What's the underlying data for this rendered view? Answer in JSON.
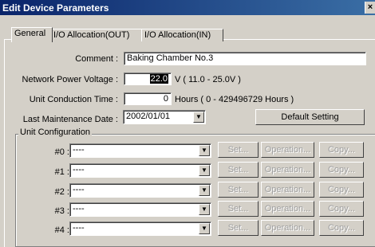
{
  "window": {
    "title": "Edit Device Parameters",
    "close_glyph": "×"
  },
  "tabs": [
    {
      "label": "General",
      "active": true
    },
    {
      "label": "I/O Allocation(OUT)",
      "active": false
    },
    {
      "label": "I/O Allocation(IN)",
      "active": false
    }
  ],
  "comment": {
    "label": "Comment :",
    "value": "Baking Chamber No.3"
  },
  "voltage": {
    "label": "Network Power Voltage :",
    "value": "22.0",
    "unit": "V ( 11.0 - 25.0V )"
  },
  "conduction": {
    "label": "Unit Conduction Time :",
    "value": "0",
    "unit": "Hours ( 0 - 429496729 Hours )"
  },
  "maintenance": {
    "label": "Last Maintenance Date :",
    "value": "2002/01/01"
  },
  "default_setting_label": "Default Setting",
  "unit_config": {
    "label": "Unit Configuration",
    "rows": [
      {
        "label": "#0 :",
        "value": "----",
        "set": "Set...",
        "operation": "Operation...",
        "copy": "Copy..."
      },
      {
        "label": "#1 :",
        "value": "----",
        "set": "Set...",
        "operation": "Operation...",
        "copy": "Copy..."
      },
      {
        "label": "#2 :",
        "value": "----",
        "set": "Set...",
        "operation": "Operation...",
        "copy": "Copy..."
      },
      {
        "label": "#3 :",
        "value": "----",
        "set": "Set...",
        "operation": "Operation...",
        "copy": "Copy..."
      },
      {
        "label": "#4 :",
        "value": "----",
        "set": "Set...",
        "operation": "Operation...",
        "copy": "Copy..."
      }
    ]
  }
}
